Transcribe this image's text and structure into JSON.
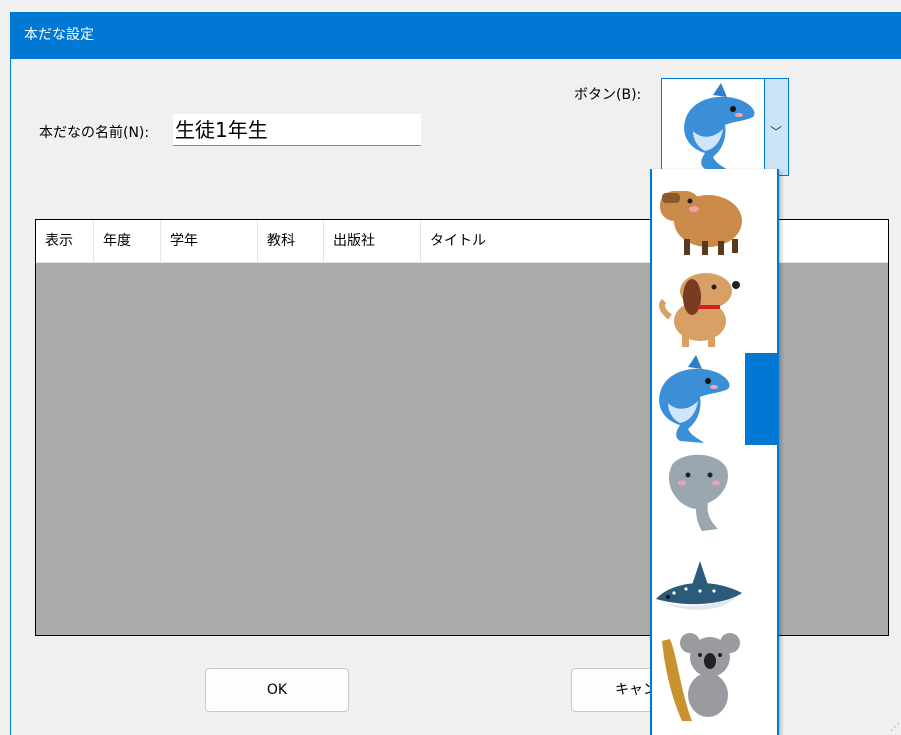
{
  "window": {
    "title": "本だな設定"
  },
  "form": {
    "name_label": "本だなの名前(N):",
    "name_value": "生徒1年生",
    "button_label": "ボタン(B):"
  },
  "combo": {
    "selected_icon": "dolphin-icon"
  },
  "dropdown": {
    "items": [
      {
        "icon": "capybara-icon"
      },
      {
        "icon": "dog-icon"
      },
      {
        "icon": "dolphin-icon",
        "selected": true
      },
      {
        "icon": "manatee-icon"
      },
      {
        "icon": "whale-shark-icon"
      },
      {
        "icon": "koala-icon"
      }
    ]
  },
  "table": {
    "columns": [
      "表示",
      "年度",
      "学年",
      "教科",
      "出版社",
      "タイトル"
    ]
  },
  "buttons": {
    "ok": "OK",
    "cancel": "キャンセ"
  },
  "colors": {
    "accent": "#0078d4",
    "list_background": "#ababab"
  }
}
